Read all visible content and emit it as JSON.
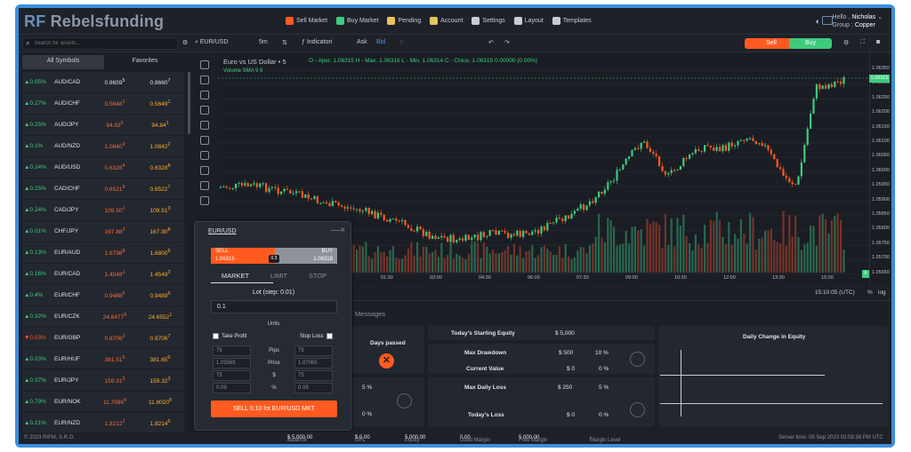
{
  "brand": {
    "logo_mark": "RF",
    "logo_text": "Rebelsfunding"
  },
  "menu": [
    {
      "label": "Sell Market",
      "icon": "sell-market-icon",
      "color": "#ff5a1f"
    },
    {
      "label": "Buy Market",
      "icon": "buy-market-icon",
      "color": "#3ecb7e"
    },
    {
      "label": "Pending",
      "icon": "clock-icon",
      "color": "#e6c35c"
    },
    {
      "label": "Account",
      "icon": "money-bag-icon",
      "color": "#e6c35c"
    },
    {
      "label": "Settings",
      "icon": "settings-icon",
      "color": "#c8ccd4"
    },
    {
      "label": "Layout",
      "icon": "layout-icon",
      "color": "#c8ccd4"
    },
    {
      "label": "Templates",
      "icon": "templates-icon",
      "color": "#c8ccd4"
    }
  ],
  "user": {
    "greeting": "Hello ,",
    "name": "Nicholas",
    "group_label": "Group :",
    "group": "Copper"
  },
  "search": {
    "placeholder": "Search for assets..."
  },
  "toolbar": {
    "symbol": "EUR/USD",
    "timeframe": "5m",
    "indicators": "Indicatori",
    "ask": "Ask",
    "bid": "Bid",
    "sell": "Sell",
    "buy": "Buy"
  },
  "watchlist": {
    "tabs": [
      "All Symbols",
      "Favorites"
    ],
    "rows": [
      {
        "chg": "▲0.05%",
        "sym": "AUD/CAD",
        "bid": "0.8659",
        "bid_sup": "5",
        "ask": "0.8660",
        "ask_sup": "7",
        "up": true,
        "g": true
      },
      {
        "chg": "▲0.27%",
        "sym": "AUD/CHF",
        "bid": "0.5648",
        "bid_sup": "1",
        "ask": "0.5649",
        "ask_sup": "1",
        "up": true,
        "g": false
      },
      {
        "chg": "▲0.25%",
        "sym": "AUD/JPY",
        "bid": "94.83",
        "bid_sup": "0",
        "ask": "94.84",
        "ask_sup": "1",
        "up": true,
        "g": false
      },
      {
        "chg": "▲0.1%",
        "sym": "AUD/NZD",
        "bid": "1.0840",
        "bid_sup": "9",
        "ask": "1.0842",
        "ask_sup": "2",
        "up": true,
        "g": false
      },
      {
        "chg": "▲0.24%",
        "sym": "AUD/USD",
        "bid": "0.6328",
        "bid_sup": "4",
        "ask": "0.6328",
        "ask_sup": "8",
        "up": true,
        "g": false
      },
      {
        "chg": "▲0.25%",
        "sym": "CAD/CHF",
        "bid": "0.6521",
        "bid_sup": "9",
        "ask": "0.6522",
        "ask_sup": "7",
        "up": true,
        "g": false
      },
      {
        "chg": "▲0.24%",
        "sym": "CAD/JPY",
        "bid": "109.50",
        "bid_sup": "1",
        "ask": "109.51",
        "ask_sup": "3",
        "up": true,
        "g": false
      },
      {
        "chg": "▲0.01%",
        "sym": "CHF/JPY",
        "bid": "167.88",
        "bid_sup": "3",
        "ask": "167.90",
        "ask_sup": "8",
        "up": true,
        "g": false
      },
      {
        "chg": "▲0.13%",
        "sym": "EUR/AUD",
        "bid": "1.6798",
        "bid_sup": "8",
        "ask": "1.6800",
        "ask_sup": "6",
        "up": true,
        "g": false
      },
      {
        "chg": "▲0.16%",
        "sym": "EUR/CAD",
        "bid": "1.4548",
        "bid_sup": "1",
        "ask": "1.4549",
        "ask_sup": "3",
        "up": true,
        "g": false
      },
      {
        "chg": "▲0.4%",
        "sym": "EUR/CHF",
        "bid": "0.9488",
        "bid_sup": "5",
        "ask": "0.9489",
        "ask_sup": "5",
        "up": true,
        "g": false
      },
      {
        "chg": "▲0.32%",
        "sym": "EUR/CZK",
        "bid": "24.6477",
        "bid_sup": "9",
        "ask": "24.6552",
        "ask_sup": "1",
        "up": true,
        "g": false
      },
      {
        "chg": "▼0.03%",
        "sym": "EUR/GBP",
        "bid": "0.8706",
        "bid_sup": "3",
        "ask": "0.8706",
        "ask_sup": "7",
        "up": false,
        "g": false
      },
      {
        "chg": "▲0.03%",
        "sym": "EUR/HUF",
        "bid": "381.51",
        "bid_sup": "5",
        "ask": "381.65",
        "ask_sup": "0",
        "up": true,
        "g": false
      },
      {
        "chg": "▲0.37%",
        "sym": "EUR/JPY",
        "bid": "159.31",
        "bid_sup": "3",
        "ask": "159.32",
        "ask_sup": "3",
        "up": true,
        "g": false
      },
      {
        "chg": "▲0.79%",
        "sym": "EUR/NOK",
        "bid": "11.7996",
        "bid_sup": "4",
        "ask": "11.8020",
        "ask_sup": "8",
        "up": true,
        "g": false
      },
      {
        "chg": "▲0.21%",
        "sym": "EUR/NZD",
        "bid": "1.8212",
        "bid_sup": "1",
        "ask": "1.8214",
        "ask_sup": "5",
        "up": true,
        "g": false
      }
    ]
  },
  "chart": {
    "title": "Euro vs US Dollar • 5",
    "ohlc": "O - Aper. 1.06315 H - Max. 1.06316 L - Min. 1.06314 C - Chius. 1.06315 0.00000 (0.00%)",
    "volume_label": "Volume SMA 9",
    "volume_value": "6",
    "y_labels": [
      "1.06350",
      "1.06315",
      "1.06250",
      "1.06200",
      "1.06150",
      "1.06100",
      "1.06050",
      "1.06000",
      "1.05950",
      "1.05900",
      "1.05850",
      "1.05800",
      "1.05750",
      "1.05700",
      "1.05650"
    ],
    "x_labels": [
      "01:30",
      "03:00",
      "04:30",
      "06:00",
      "07:30",
      "09:00",
      "10:30",
      "12:00",
      "13:30",
      "15:00"
    ],
    "vol_tag": "6",
    "time": "15:10:05 (UTC)",
    "pct": "%",
    "log": "log",
    "auto": "auto"
  },
  "bottom": {
    "messages": "Messages",
    "todays_equity": "Today's Starting Equity",
    "todays_equity_val": "$ 5,000",
    "days_passed": "Days passed",
    "max_dd": "Max Drawdown",
    "max_dd_val": "$ 500",
    "max_dd_pct": "10 %",
    "current_value": "Current Value",
    "cv_val": "$ 0",
    "cv_pct": "0 %",
    "max_daily": "Max Daily Loss",
    "max_daily_val": "$ 250",
    "max_daily_pct": "5 %",
    "todays_loss": "Today's Loss",
    "tl_val": "$ 0",
    "tl_pct": "0 %",
    "left_pct1": "5 %",
    "left_pct2": "0 %",
    "daily_change": "Daily Change in Equity"
  },
  "order": {
    "symbol": "EUR/USD",
    "sell_label": "SELL",
    "sell_price": "1.06315",
    "buy_label": "BUY",
    "buy_price": "1.06318",
    "spread": "0.3",
    "tabs": [
      "MARKET",
      "LIMIT",
      "STOP"
    ],
    "lot_label": "Lot (step: 0.01)",
    "lot_value": "0.1",
    "units": "Units",
    "take_profit": "Take Profit",
    "stop_loss": "Stop Loss",
    "tp_pips": "75",
    "tp_price": "1.05565",
    "tp_money": "75",
    "tp_pct": "0.09",
    "lab_pips": "Pips",
    "lab_price": "Price",
    "lab_money": "$",
    "lab_pct": "%",
    "sl_pips": "75",
    "sl_price": "1.07065",
    "sl_money": "75",
    "sl_pct": "0.09",
    "submit": "SELL 0.10 lot EUR/USD MKT"
  },
  "footer": {
    "copyright": "© 2023 RIFM, S.R.O.",
    "balance_label": "Balance",
    "balance": "$ 5,000.00",
    "upl_label": "UPL",
    "upl": "$ 0.00",
    "equity_label": "Equity",
    "equity": "5,000.00",
    "used_margin_label": "Used Margin",
    "used_margin": "0.00",
    "free_margin_label": "Free Margin",
    "free_margin": "5,000.00",
    "margin_level_label": "Margin Level",
    "margin_level": "-",
    "server_time": "Server time: 05 Sep 2023 03:08:36 PM UTC"
  }
}
